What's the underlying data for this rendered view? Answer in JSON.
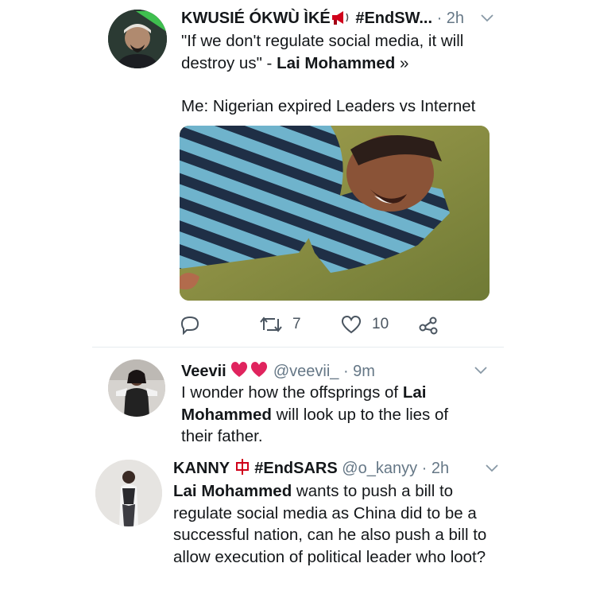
{
  "tweets": [
    {
      "name": "KWUSIÉ ÓKWÙ ÌKÉ",
      "tag": "#EndSW...",
      "time": "· 2h",
      "text_line1": "\"If we don't regulate social media, it will destroy us\" - ",
      "text_bold": "Lai Mohammed",
      "text_after": " »",
      "text_line2": "Me: Nigerian expired Leaders vs Internet",
      "stats": {
        "retweets": "7",
        "likes": "10"
      }
    },
    {
      "name": "Veevii",
      "handle": "@veevii_",
      "time": "· 9m",
      "text_before": "I wonder how the offsprings of ",
      "text_bold": "Lai Mohammed",
      "text_after": " will look up to the lies of their father."
    },
    {
      "name": "KANNY",
      "tag": "#EndSARS",
      "handle": "@o_kanyy",
      "time": "· 2h",
      "text_bold": "Lai Mohammed",
      "text_after": " wants to push a bill to regulate social media as China did to be a successful nation, can he also push a bill to allow execution of political leader who loot?"
    }
  ],
  "icons": {
    "reply": "reply-icon",
    "retweet": "retweet-icon",
    "like": "heart-icon",
    "share": "share-icon",
    "more": "chevron-down-icon",
    "megaphone": "megaphone-icon",
    "hearts": "red-heart-icon",
    "flag": "china-character-icon"
  },
  "colors": {
    "text": "#14171a",
    "muted": "#657786",
    "action": "#4a5560",
    "divider": "#e6ecf0",
    "heart_red": "#e0245e",
    "flag_red": "#d0021b"
  }
}
